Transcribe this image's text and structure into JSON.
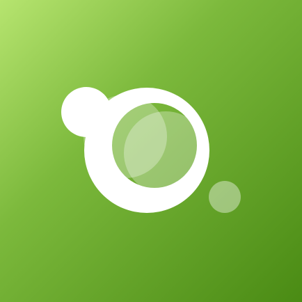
{
  "app": {
    "logo_icon": "app-logo-circles-icon",
    "colors": {
      "gradient_light": "#b6e46f",
      "gradient_mid": "#7cb93c",
      "gradient_dark": "#4a8b14",
      "mark_white": "#ffffff"
    }
  }
}
